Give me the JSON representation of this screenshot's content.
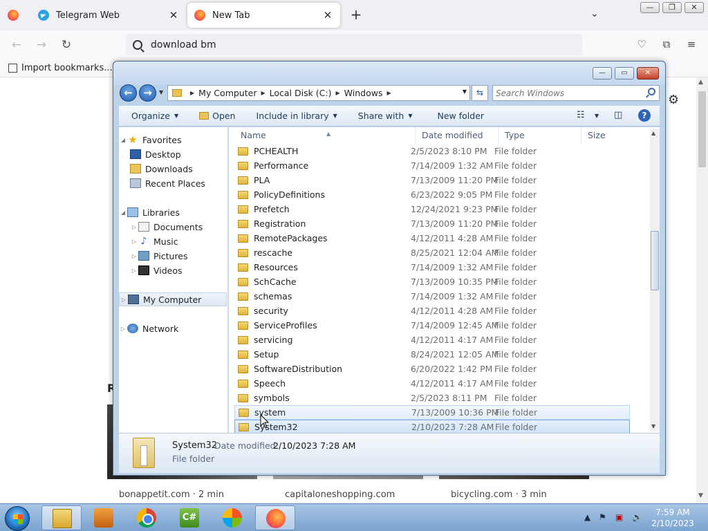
{
  "browser": {
    "tabs": [
      {
        "label": "Telegram Web"
      },
      {
        "label": "New Tab"
      }
    ],
    "url": "download bm",
    "bookmark": "Import bookmarks..."
  },
  "ntp": {
    "section_initial": "R",
    "cards": [
      {
        "source": "bonappetit.com · 2 min"
      },
      {
        "source": "capitaloneshopping.com"
      },
      {
        "source": "bicycling.com · 3 min"
      }
    ]
  },
  "explorer": {
    "breadcrumbs": [
      "My Computer",
      "Local Disk (C:)",
      "Windows"
    ],
    "search_placeholder": "Search Windows",
    "commands": {
      "organize": "Organize",
      "open": "Open",
      "include": "Include in library",
      "share": "Share with",
      "new_folder": "New folder"
    },
    "nav": {
      "favorites": "Favorites",
      "desktop": "Desktop",
      "downloads": "Downloads",
      "recent": "Recent Places",
      "libraries": "Libraries",
      "documents": "Documents",
      "music": "Music",
      "pictures": "Pictures",
      "videos": "Videos",
      "computer": "My Computer",
      "network": "Network"
    },
    "columns": {
      "name": "Name",
      "date": "Date modified",
      "type": "Type",
      "size": "Size"
    },
    "files": [
      {
        "name": "PCHEALTH",
        "date": "2/5/2023 8:10 PM",
        "type": "File folder"
      },
      {
        "name": "Performance",
        "date": "7/14/2009 1:32 AM",
        "type": "File folder"
      },
      {
        "name": "PLA",
        "date": "7/13/2009 11:20 PM",
        "type": "File folder"
      },
      {
        "name": "PolicyDefinitions",
        "date": "6/23/2022 9:05 PM",
        "type": "File folder"
      },
      {
        "name": "Prefetch",
        "date": "12/24/2021 9:23 PM",
        "type": "File folder"
      },
      {
        "name": "Registration",
        "date": "7/13/2009 11:20 PM",
        "type": "File folder"
      },
      {
        "name": "RemotePackages",
        "date": "4/12/2011 4:28 AM",
        "type": "File folder"
      },
      {
        "name": "rescache",
        "date": "8/25/2021 12:04 AM",
        "type": "File folder"
      },
      {
        "name": "Resources",
        "date": "7/14/2009 1:32 AM",
        "type": "File folder"
      },
      {
        "name": "SchCache",
        "date": "7/13/2009 10:35 PM",
        "type": "File folder"
      },
      {
        "name": "schemas",
        "date": "7/14/2009 1:32 AM",
        "type": "File folder"
      },
      {
        "name": "security",
        "date": "4/12/2011 4:28 AM",
        "type": "File folder"
      },
      {
        "name": "ServiceProfiles",
        "date": "7/14/2009 12:45 AM",
        "type": "File folder"
      },
      {
        "name": "servicing",
        "date": "4/12/2011 4:17 AM",
        "type": "File folder"
      },
      {
        "name": "Setup",
        "date": "8/24/2021 12:05 AM",
        "type": "File folder"
      },
      {
        "name": "SoftwareDistribution",
        "date": "6/20/2022 1:42 PM",
        "type": "File folder"
      },
      {
        "name": "Speech",
        "date": "4/12/2011 4:17 AM",
        "type": "File folder"
      },
      {
        "name": "symbols",
        "date": "2/5/2023 8:11 PM",
        "type": "File folder"
      },
      {
        "name": "system",
        "date": "7/13/2009 10:36 PM",
        "type": "File folder"
      },
      {
        "name": "System32",
        "date": "2/10/2023 7:28 AM",
        "type": "File folder"
      }
    ],
    "details": {
      "name": "System32",
      "modified_label": "Date modified:",
      "modified_value": "2/10/2023 7:28 AM",
      "type": "File folder"
    }
  },
  "taskbar": {
    "time": "7:59 AM",
    "date": "2/10/2023",
    "apps": [
      "windows-explorer",
      "media-player",
      "chrome",
      "csharp-ide",
      "windows-update",
      "firefox"
    ]
  }
}
